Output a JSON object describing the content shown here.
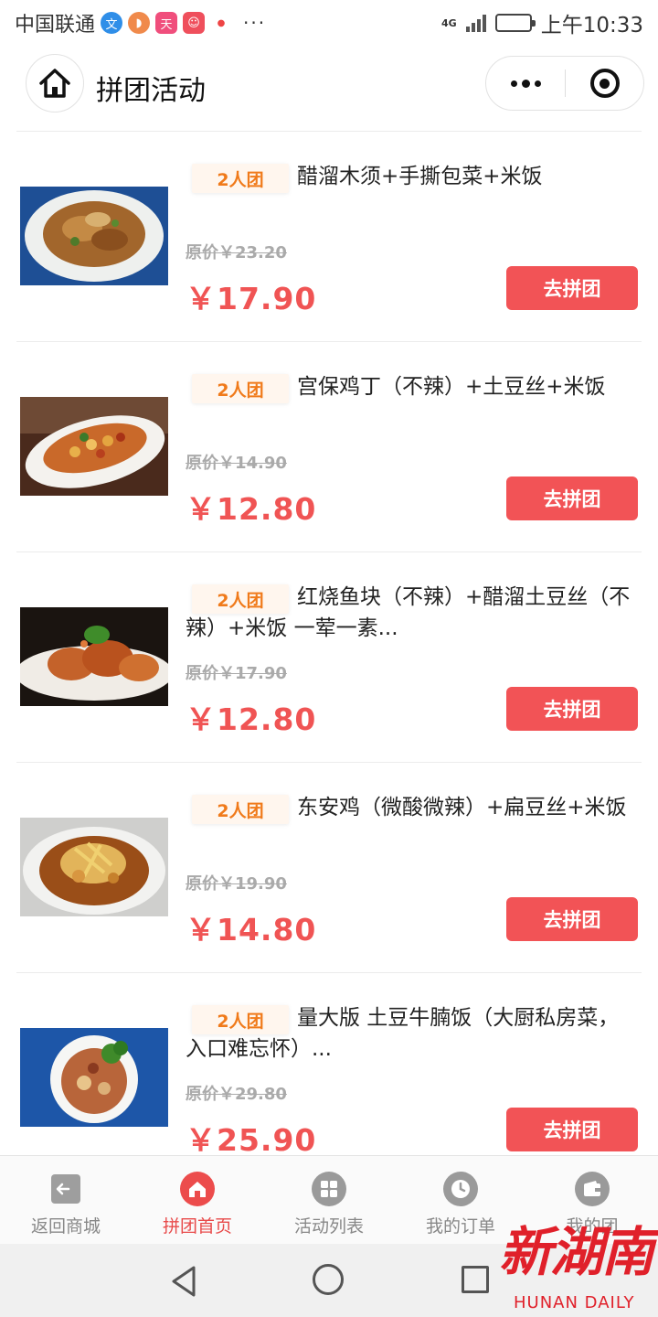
{
  "status_bar": {
    "carrier": "中国联通",
    "network": "4G",
    "battery_level": 0.5,
    "time": "上午10:33",
    "more": "···"
  },
  "nav": {
    "title": "拼团活动"
  },
  "products": [
    {
      "tag": "2人团",
      "title": "醋溜木须+手撕包菜+米饭",
      "original_price": "原价￥23.20",
      "price": "￥17.90",
      "button": "去拼团",
      "image_icon": "stir-fried-pork-dish"
    },
    {
      "tag": "2人团",
      "title": "宫保鸡丁（不辣）+土豆丝+米饭",
      "original_price": "原价￥14.90",
      "price": "￥12.80",
      "button": "去拼团",
      "image_icon": "kung-pao-chicken-dish"
    },
    {
      "tag": "2人团",
      "title": "红烧鱼块（不辣）+醋溜土豆丝（不辣）+米饭 一荤一素...",
      "original_price": "原价￥17.90",
      "price": "￥12.80",
      "button": "去拼团",
      "image_icon": "braised-fish-dish"
    },
    {
      "tag": "2人团",
      "title": "东安鸡（微酸微辣）+扁豆丝+米饭",
      "original_price": "原价￥19.90",
      "price": "￥14.80",
      "button": "去拼团",
      "image_icon": "dongan-chicken-dish"
    },
    {
      "tag": "2人团",
      "title": "量大版 土豆牛腩饭（大厨私房菜，入口难忘怀）...",
      "original_price": "原价￥29.80",
      "price": "￥25.90",
      "button": "去拼团",
      "image_icon": "beef-brisket-dish"
    }
  ],
  "tabbar": {
    "items": [
      {
        "label": "返回商城",
        "icon": "exit-icon",
        "active": false
      },
      {
        "label": "拼团首页",
        "icon": "home-icon",
        "active": true
      },
      {
        "label": "活动列表",
        "icon": "grid-icon",
        "active": false
      },
      {
        "label": "我的订单",
        "icon": "clock-icon",
        "active": false
      },
      {
        "label": "我的团",
        "icon": "wallet-icon",
        "active": false
      }
    ]
  },
  "colors": {
    "accent": "#f25356",
    "price": "#f05454",
    "tag_text": "#f07a1a",
    "tag_bg": "#fff6ee"
  },
  "watermark": {
    "cn": "新湖南",
    "en": "HUNAN DAILY"
  }
}
